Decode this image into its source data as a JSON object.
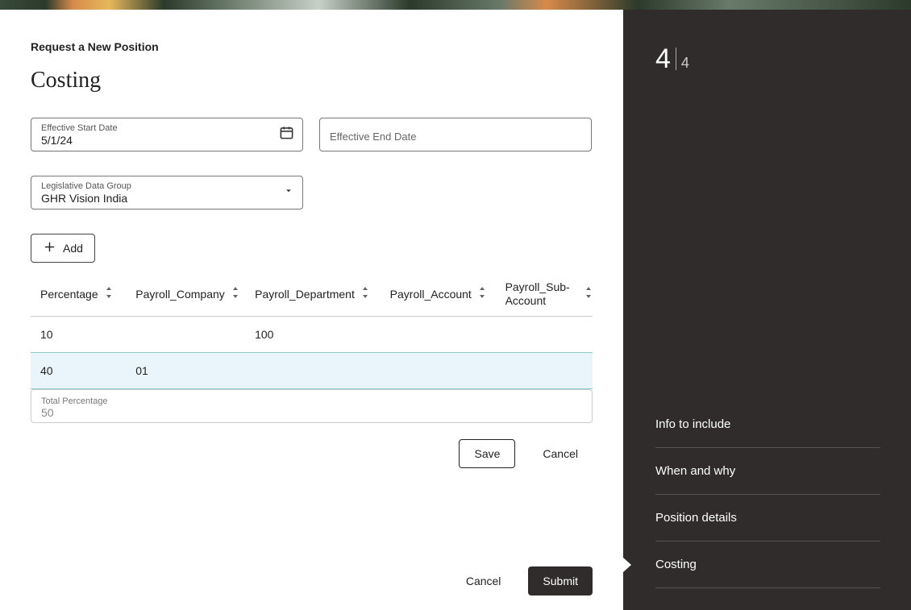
{
  "breadcrumb": "Request a New Position",
  "page_title": "Costing",
  "fields": {
    "start_date": {
      "label": "Effective Start Date",
      "value": "5/1/24"
    },
    "end_date": {
      "label": "Effective End Date",
      "value": ""
    },
    "ldg": {
      "label": "Legislative Data Group",
      "value": "GHR Vision India"
    }
  },
  "add_label": "Add",
  "columns": {
    "percentage": "Percentage",
    "company": "Payroll_Company",
    "department": "Payroll_Department",
    "account": "Payroll_Account",
    "sub_account": "Payroll_Sub-Account"
  },
  "rows": [
    {
      "percentage": "10",
      "company": "",
      "department": "100",
      "account": "",
      "sub": ""
    },
    {
      "percentage": "40",
      "company": "01",
      "department": "",
      "account": "",
      "sub": ""
    }
  ],
  "total": {
    "label": "Total Percentage",
    "value": "50"
  },
  "section_actions": {
    "save": "Save",
    "cancel": "Cancel"
  },
  "page_actions": {
    "cancel": "Cancel",
    "submit": "Submit"
  },
  "step": {
    "current": "4",
    "total": "4"
  },
  "nav": [
    "Info to include",
    "When and why",
    "Position details",
    "Costing"
  ]
}
